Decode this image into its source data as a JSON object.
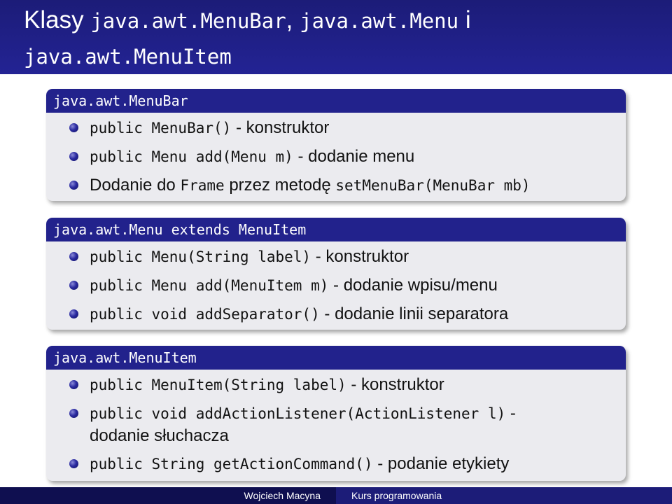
{
  "title": {
    "word1": "Klasy ",
    "class1": "java.awt.MenuBar",
    "sep1": ", ",
    "class2": "java.awt.Menu",
    "conj": " i",
    "class3": "java.awt.MenuItem"
  },
  "blocks": [
    {
      "heading": "java.awt.MenuBar",
      "items": [
        {
          "code": "public MenuBar()",
          "text": " - konstruktor"
        },
        {
          "code": "public Menu add(Menu m)",
          "text": " - dodanie menu"
        },
        {
          "pre": "Dodanie do ",
          "code": "Frame",
          "mid": " przez metodę ",
          "code2": "setMenuBar(MenuBar mb)"
        }
      ]
    },
    {
      "heading": "java.awt.Menu extends MenuItem",
      "items": [
        {
          "code": "public Menu(String label)",
          "text": " - konstruktor"
        },
        {
          "code": "public Menu add(MenuItem m)",
          "text": " - dodanie wpisu/menu"
        },
        {
          "code": "public void addSeparator()",
          "text": " - dodanie linii separatora"
        }
      ]
    },
    {
      "heading": "java.awt.MenuItem",
      "items": [
        {
          "code": "public MenuItem(String label)",
          "text": " - konstruktor"
        },
        {
          "code": "public void addActionListener(ActionListener l)",
          "text": " -",
          "line2": "dodanie słuchacza"
        },
        {
          "code": "public String getActionCommand()",
          "text": " - podanie etykiety"
        }
      ]
    }
  ],
  "footer": {
    "author": "Wojciech Macyna",
    "course": "Kurs programowania"
  },
  "colors": {
    "title_bg": "#1c1c78",
    "block_head_bg": "#22228c",
    "block_body_bg": "#ebebef"
  }
}
